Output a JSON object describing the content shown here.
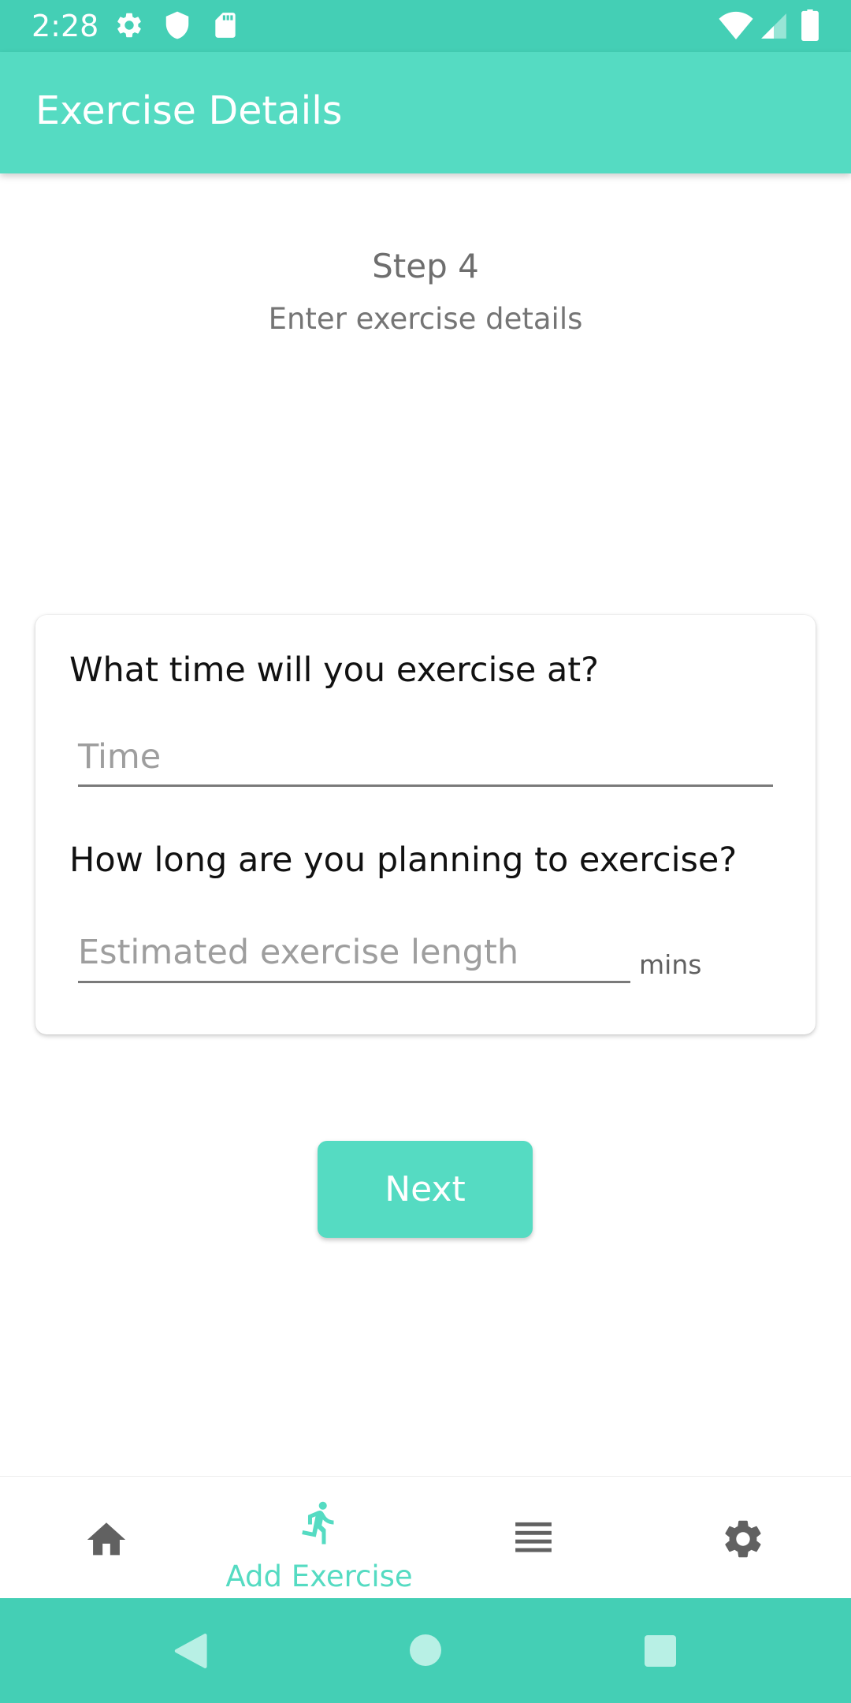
{
  "status_bar": {
    "time": "2:28",
    "icons": [
      "gear-icon",
      "shield-icon",
      "sd-card-icon",
      "wifi-icon",
      "signal-icon",
      "battery-icon"
    ]
  },
  "app_bar": {
    "title": "Exercise Details"
  },
  "step": {
    "title": "Step 4",
    "subtitle": "Enter exercise details"
  },
  "form": {
    "time_question": "What time will you exercise at?",
    "time_placeholder": "Time",
    "length_question": "How long are you planning to exercise?",
    "length_placeholder": "Estimated exercise length",
    "length_unit": "mins"
  },
  "actions": {
    "next_label": "Next"
  },
  "bottom_nav": {
    "items": [
      {
        "icon": "home-icon",
        "label": ""
      },
      {
        "icon": "running-person-icon",
        "label": "Add Exercise",
        "selected": true
      },
      {
        "icon": "list-icon",
        "label": ""
      },
      {
        "icon": "gear-icon",
        "label": ""
      }
    ]
  },
  "system_nav": {
    "buttons": [
      "back-icon",
      "home-circle-icon",
      "recents-icon"
    ]
  },
  "colors": {
    "primary": "#55dbc2",
    "primary_dark": "#44cfb5",
    "text_secondary": "#757575"
  }
}
